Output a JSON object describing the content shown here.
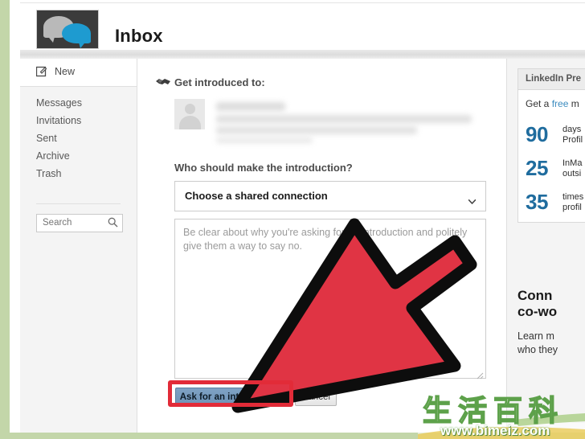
{
  "header": {
    "title": "Inbox",
    "logo_icon": "speech-bubbles-icon"
  },
  "sidebar": {
    "new_label": "New",
    "new_icon": "compose-icon",
    "items": [
      {
        "label": "Messages"
      },
      {
        "label": "Invitations"
      },
      {
        "label": "Sent"
      },
      {
        "label": "Archive"
      },
      {
        "label": "Trash"
      }
    ],
    "search": {
      "placeholder": "Search",
      "value": "",
      "icon": "search-icon"
    }
  },
  "main": {
    "intro_heading": "Get introduced to:",
    "intro_icon": "handshake-icon",
    "recipient": {
      "avatar_icon": "person-avatar-icon",
      "name_blurred": true
    },
    "question_label": "Who should make the introduction?",
    "connection_select": {
      "value": "Choose a shared connection",
      "chevron_icon": "chevron-down-icon"
    },
    "message_textarea": {
      "placeholder": "Be clear about why you're asking for an introduction and politely give them a way to say no.",
      "value": ""
    },
    "primary_button": "Ask for an introduction",
    "secondary_button": "Cancel"
  },
  "rail": {
    "promo_tab": "LinkedIn Pre",
    "promo_subtitle_pre": "Get a ",
    "promo_subtitle_link": "free",
    "promo_subtitle_post": " m",
    "stats": [
      {
        "number": "90",
        "line1": "days",
        "line2": "Profil"
      },
      {
        "number": "25",
        "line1": "InMa",
        "line2": "outsi"
      },
      {
        "number": "35",
        "line1": "times",
        "line2": "profil"
      }
    ],
    "promo2_title_line1": "Conn",
    "promo2_title_line2": "co-wo",
    "promo2_body_line1": "Learn m",
    "promo2_body_line2": "who they"
  },
  "annotation": {
    "arrow_icon": "red-arrow-pointer",
    "arrow_color": "#e03444",
    "arrow_outline": "#0d0d0d",
    "highlight_color": "#e22b38"
  },
  "watermark": {
    "characters": "生活百科",
    "url": "www.bimeiz.com"
  }
}
